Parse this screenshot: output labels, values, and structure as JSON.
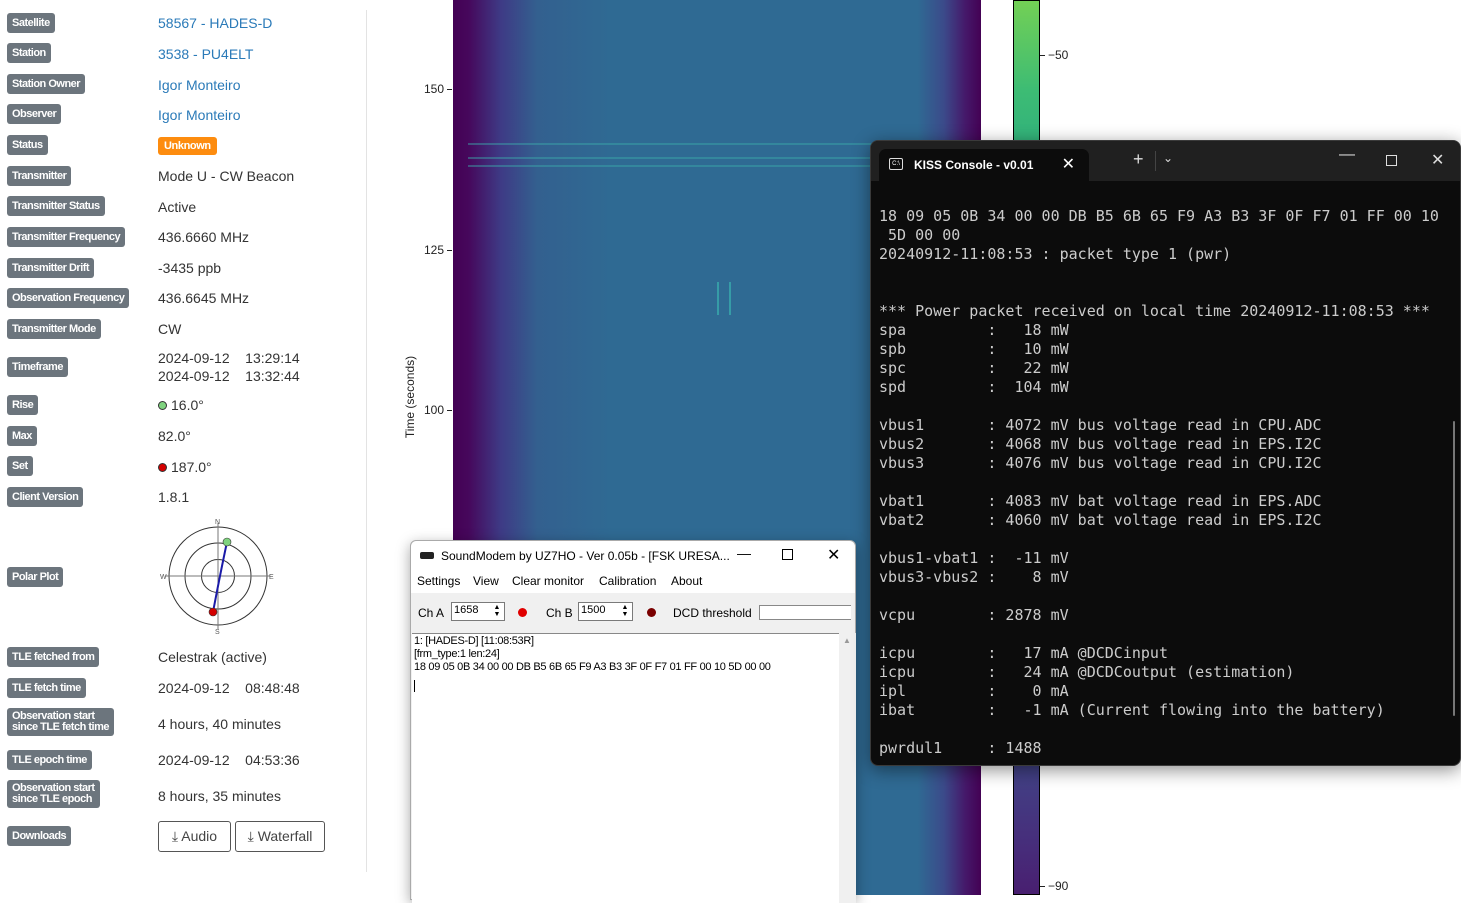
{
  "observation": {
    "rows": [
      {
        "label": "Satellite",
        "value": "58567 - HADES-D"
      },
      {
        "label": "Station",
        "value": "3538 - PU4ELT"
      },
      {
        "label": "Station Owner",
        "value": "Igor Monteiro"
      },
      {
        "label": "Observer",
        "value": "Igor Monteiro"
      },
      {
        "label": "Status",
        "value": "Unknown"
      },
      {
        "label": "Transmitter",
        "value": "Mode U - CW Beacon"
      },
      {
        "label": "Transmitter Status",
        "value": "Active"
      },
      {
        "label": "Transmitter Frequency",
        "value": "436.6660 MHz"
      },
      {
        "label": "Transmitter Drift",
        "value": "-3435 ppb"
      },
      {
        "label": "Observation Frequency",
        "value": "436.6645 MHz"
      },
      {
        "label": "Transmitter Mode",
        "value": "CW"
      },
      {
        "label": "Timeframe",
        "value": "2024-09-12    13:29:14",
        "value2": "2024-09-12    13:32:44"
      },
      {
        "label": "Rise",
        "value": "16.0°"
      },
      {
        "label": "Max",
        "value": "82.0°"
      },
      {
        "label": "Set",
        "value": "187.0°"
      },
      {
        "label": "Client Version",
        "value": "1.8.1"
      },
      {
        "label": "Polar Plot"
      },
      {
        "label": "TLE fetched from",
        "value": "Celestrak (active)"
      },
      {
        "label": "TLE fetch time",
        "value": "2024-09-12    08:48:48"
      },
      {
        "label": "Observation start",
        "label2": "since TLE fetch time",
        "value": "4 hours, 40 minutes"
      },
      {
        "label": "TLE epoch time",
        "value": "2024-09-12    04:53:36"
      },
      {
        "label": "Observation start",
        "label2": "since TLE epoch",
        "value": "8 hours, 35 minutes"
      },
      {
        "label": "Downloads",
        "audio": "Audio",
        "waterfall": "Waterfall"
      }
    ],
    "polar": {
      "n": "N",
      "s": "S",
      "e": "E",
      "w": "W",
      "rise_color": "#7fd37f",
      "set_color": "#d40000"
    },
    "status_color": "#fd8c0f"
  },
  "waterfall": {
    "ylabel": "Time (seconds)",
    "yticks": [
      "150",
      "125",
      "100"
    ],
    "colorbar_ticks": [
      "−50",
      "−90"
    ]
  },
  "kiss": {
    "title": "KISS Console - v0.01",
    "lines": [
      "18 09 05 0B 34 00 00 DB B5 6B 65 F9 A3 B3 3F 0F F7 01 FF 00 10",
      " 5D 00 00",
      "20240912-11:08:53 : packet type 1 (pwr)",
      "",
      "",
      "*** Power packet received on local time 20240912-11:08:53 ***",
      "spa         :   18 mW",
      "spb         :   10 mW",
      "spc         :   22 mW",
      "spd         :  104 mW",
      "",
      "vbus1       : 4072 mV bus voltage read in CPU.ADC",
      "vbus2       : 4068 mV bus voltage read in EPS.I2C",
      "vbus3       : 4076 mV bus voltage read in CPU.I2C",
      "",
      "vbat1       : 4083 mV bat voltage read in EPS.ADC",
      "vbat2       : 4060 mV bat voltage read in EPS.I2C",
      "",
      "vbus1-vbat1 :  -11 mV",
      "vbus3-vbus2 :    8 mV",
      "",
      "vcpu        : 2878 mV",
      "",
      "icpu        :   17 mA @DCDCinput",
      "icpu        :   24 mA @DCDCoutput (estimation)",
      "ipl         :    0 mA",
      "ibat        :   -1 mA (Current flowing into the battery)",
      "",
      "pwrdul1     : 1488"
    ]
  },
  "soundmodem": {
    "title": "SoundModem by UZ7HO - Ver 0.05b - [FSK URESA...",
    "menu": [
      "Settings",
      "View",
      "Clear monitor",
      "Calibration",
      "About"
    ],
    "cha_label": "Ch A",
    "cha_value": "1658",
    "chb_label": "Ch B",
    "chb_value": "1500",
    "dcd_label": "DCD threshold",
    "monitor": [
      "1: [HADES-D] [11:08:53R]",
      "[frm_type:1 len:24]",
      "18 09 05 0B 34 00 00 DB B5 6B 65 F9 A3 B3 3F 0F F7 01 FF 00 10 5D 00 00"
    ]
  }
}
